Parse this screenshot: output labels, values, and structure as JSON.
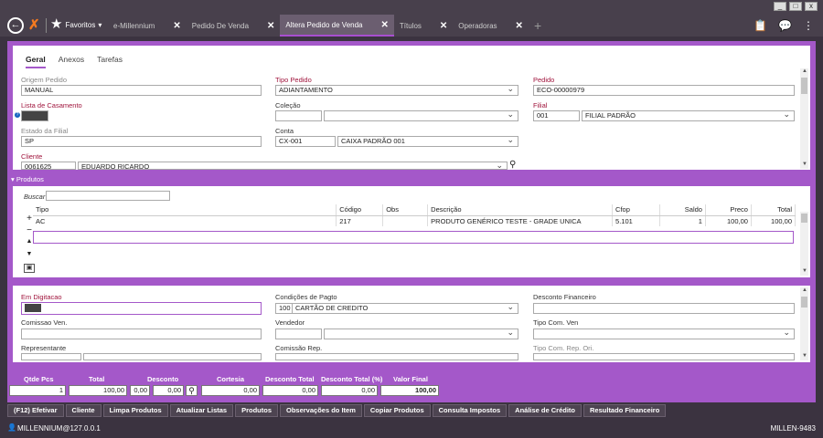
{
  "app": {
    "favorites": "Favoritos",
    "tabs": [
      {
        "label": "e-Millennium"
      },
      {
        "label": "Pedido De Venda"
      },
      {
        "label": "Altera Pedido de Venda"
      },
      {
        "label": "Títulos"
      },
      {
        "label": "Operadoras"
      }
    ],
    "window_controls": {
      "minimize": "_",
      "maximize": "□",
      "close": "x"
    }
  },
  "subtabs": [
    "Geral",
    "Anexos",
    "Tarefas"
  ],
  "form": {
    "origem_pedido_label": "Origem Pedido",
    "origem_pedido_value": "MANUAL",
    "tipo_pedido_label": "Tipo Pedido",
    "tipo_pedido_value": "ADIANTAMENTO",
    "pedido_label": "Pedido",
    "pedido_value": "ECO-00000979",
    "lista_casamento_label": "Lista de Casamento",
    "colecao_label": "Coleção",
    "filial_label": "Filial",
    "filial_code": "001",
    "filial_name": "FILIAL PADRÃO",
    "estado_filial_label": "Estado da Filial",
    "estado_filial_value": "SP",
    "conta_label": "Conta",
    "conta_code": "CX-001",
    "conta_name": "CAIXA PADRÃO 001",
    "cliente_label": "Cliente",
    "cliente_code": "0061625",
    "cliente_name": "EDUARDO RICARDO"
  },
  "produtos": {
    "section_title": "Produtos",
    "buscar_label": "Buscar",
    "columns": [
      "Tipo",
      "Código",
      "Obs",
      "Descrição",
      "Cfop",
      "Saldo",
      "Preco",
      "Total"
    ],
    "rows": [
      {
        "tipo": "AC",
        "codigo": "217",
        "obs": "",
        "descricao": "PRODUTO GENÉRICO TESTE - GRADE UNICA",
        "cfop": "5.101",
        "saldo": "1",
        "preco": "100,00",
        "total": "100,00"
      }
    ],
    "row_controls": [
      "+",
      "−",
      "▲",
      "▼"
    ]
  },
  "form2": {
    "em_digitacao_label": "Em Digitacao",
    "condicoes_label": "Condições de Pagto",
    "condicoes_code": "100",
    "condicoes_name": "CARTÃO DE CREDITO",
    "desconto_fin_label": "Desconto Financeiro",
    "comissao_ven_label": "Comissao Ven.",
    "vendedor_label": "Vendedor",
    "tipo_com_ven_label": "Tipo Com. Ven",
    "representante_label": "Representante",
    "comissao_rep_label": "Comissão Rep.",
    "tipo_com_rep_label": "Tipo Com. Rep. Ori."
  },
  "totals": {
    "qtde_label": "Qtde Pcs",
    "qtde": "1",
    "total_label": "Total",
    "total": "100,00",
    "desconto_label": "Desconto",
    "desconto_a": "0,00",
    "desconto_b": "0,00",
    "cortesia_label": "Cortesia",
    "cortesia": "0,00",
    "desc_total_label": "Desconto Total",
    "desc_total": "0,00",
    "desc_total_pct_label": "Desconto Total (%)",
    "desc_total_pct": "0,00",
    "valor_final_label": "Valor Final",
    "valor_final": "100,00"
  },
  "buttons": [
    "(F12) Efetivar",
    "Cliente",
    "Limpa Produtos",
    "Atualizar Listas",
    "Produtos",
    "Observações do Item",
    "Copiar Produtos",
    "Consulta Impostos",
    "Análise de Crédito",
    "Resultado Financeiro"
  ],
  "status": {
    "user": "MILLENNIUM@127.0.0.1",
    "server": "MILLEN-9483"
  }
}
